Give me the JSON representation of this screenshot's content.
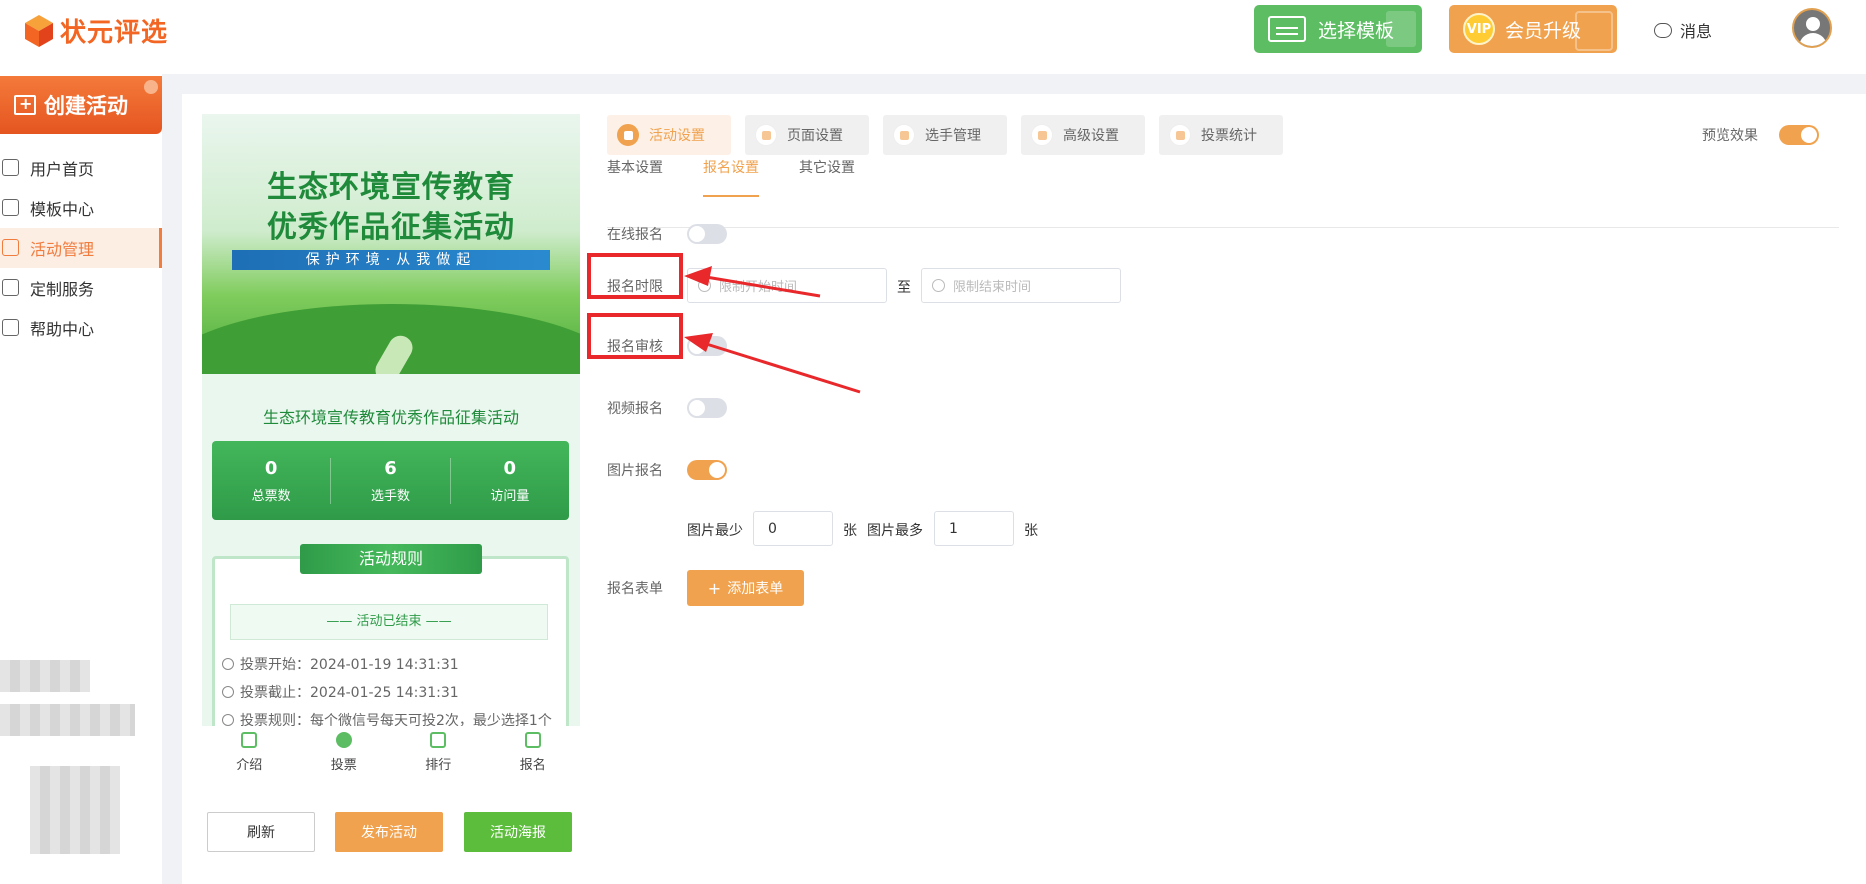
{
  "header": {
    "logo_text": "状元评选",
    "template_button": "选择模板",
    "vip_badge": "VIP",
    "vip_button": "会员升级",
    "messages": "消息"
  },
  "sidebar": {
    "create_button": "创建活动",
    "items": [
      {
        "label": "用户首页"
      },
      {
        "label": "模板中心"
      },
      {
        "label": "活动管理",
        "active": true
      },
      {
        "label": "定制服务"
      },
      {
        "label": "帮助中心"
      }
    ]
  },
  "preview": {
    "banner_title_1": "生态环境宣传教育",
    "banner_title_2": "优秀作品征集活动",
    "banner_slogan": "保护环境·从我做起",
    "activity_title": "生态环境宣传教育优秀作品征集活动",
    "stats": [
      {
        "value": "0",
        "label": "总票数"
      },
      {
        "value": "6",
        "label": "选手数"
      },
      {
        "value": "0",
        "label": "访问量"
      }
    ],
    "rules_title": "活动规则",
    "ended_text": "—— 活动已结束 ——",
    "rule_lines": [
      "投票开始：2024-01-19 14:31:31",
      "投票截止：2024-01-25 14:31:31",
      "投票规则：每个微信号每天可投2次，最少选择1个"
    ],
    "tabs": [
      {
        "label": "介绍"
      },
      {
        "label": "投票",
        "active": true
      },
      {
        "label": "排行"
      },
      {
        "label": "报名"
      }
    ],
    "buttons": {
      "refresh": "刷新",
      "publish": "发布活动",
      "poster": "活动海报"
    }
  },
  "settings": {
    "top_tabs": [
      {
        "label": "活动设置",
        "active": true
      },
      {
        "label": "页面设置"
      },
      {
        "label": "选手管理"
      },
      {
        "label": "高级设置"
      },
      {
        "label": "投票统计"
      }
    ],
    "preview_label": "预览效果",
    "preview_on": true,
    "sub_tabs": [
      {
        "label": "基本设置"
      },
      {
        "label": "报名设置",
        "active": true
      },
      {
        "label": "其它设置"
      }
    ],
    "fields": {
      "online_signup": {
        "label": "在线报名",
        "on": false
      },
      "signup_time": {
        "label": "报名时限",
        "start_placeholder": "限制开始时间",
        "to": "至",
        "end_placeholder": "限制结束时间"
      },
      "signup_review": {
        "label": "报名审核",
        "on": false
      },
      "video_signup": {
        "label": "视频报名",
        "on": false
      },
      "image_signup": {
        "label": "图片报名",
        "on": true
      },
      "image_min_label": "图片最少",
      "image_min_value": "0",
      "image_unit": "张",
      "image_max_label": "图片最多",
      "image_max_value": "1",
      "signup_form": {
        "label": "报名表单",
        "button": "添加表单"
      }
    }
  },
  "colors": {
    "accent": "#f0a24e",
    "green": "#5cbd63",
    "highlight": "#e8282b"
  }
}
